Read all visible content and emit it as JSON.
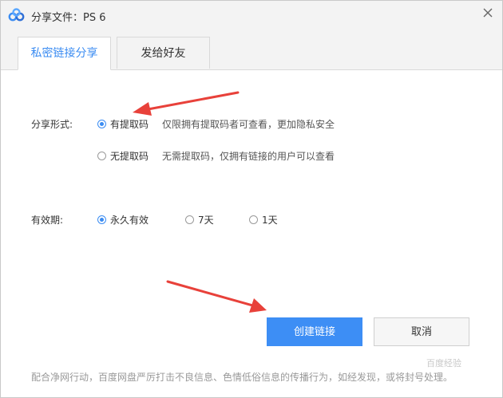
{
  "window": {
    "title": "分享文件：PS 6",
    "close_glyph": "×"
  },
  "tabs": [
    {
      "label": "私密链接分享",
      "active": true
    },
    {
      "label": "发给好友",
      "active": false
    }
  ],
  "share_form": {
    "label": "分享形式:",
    "options": [
      {
        "label": "有提取码",
        "description": "仅限拥有提取码者可查看，更加隐私安全",
        "checked": true
      },
      {
        "label": "无提取码",
        "description": "无需提取码，仅拥有链接的用户可以查看",
        "checked": false
      }
    ]
  },
  "validity": {
    "label": "有效期:",
    "options": [
      {
        "label": "永久有效",
        "checked": true
      },
      {
        "label": "7天",
        "checked": false
      },
      {
        "label": "1天",
        "checked": false
      }
    ]
  },
  "buttons": {
    "create_label": "创建链接",
    "cancel_label": "取消"
  },
  "footer_text": "配合净网行动，百度网盘严厉打击不良信息、色情低俗信息的传播行为，如经发现，或将封号处理。",
  "watermark_text": "百度经验",
  "colors": {
    "accent": "#3b8cf2",
    "annotation_arrow": "#e8413a"
  },
  "icons": {
    "app": "baidu-netdisk-logo-icon",
    "close": "close-icon"
  }
}
